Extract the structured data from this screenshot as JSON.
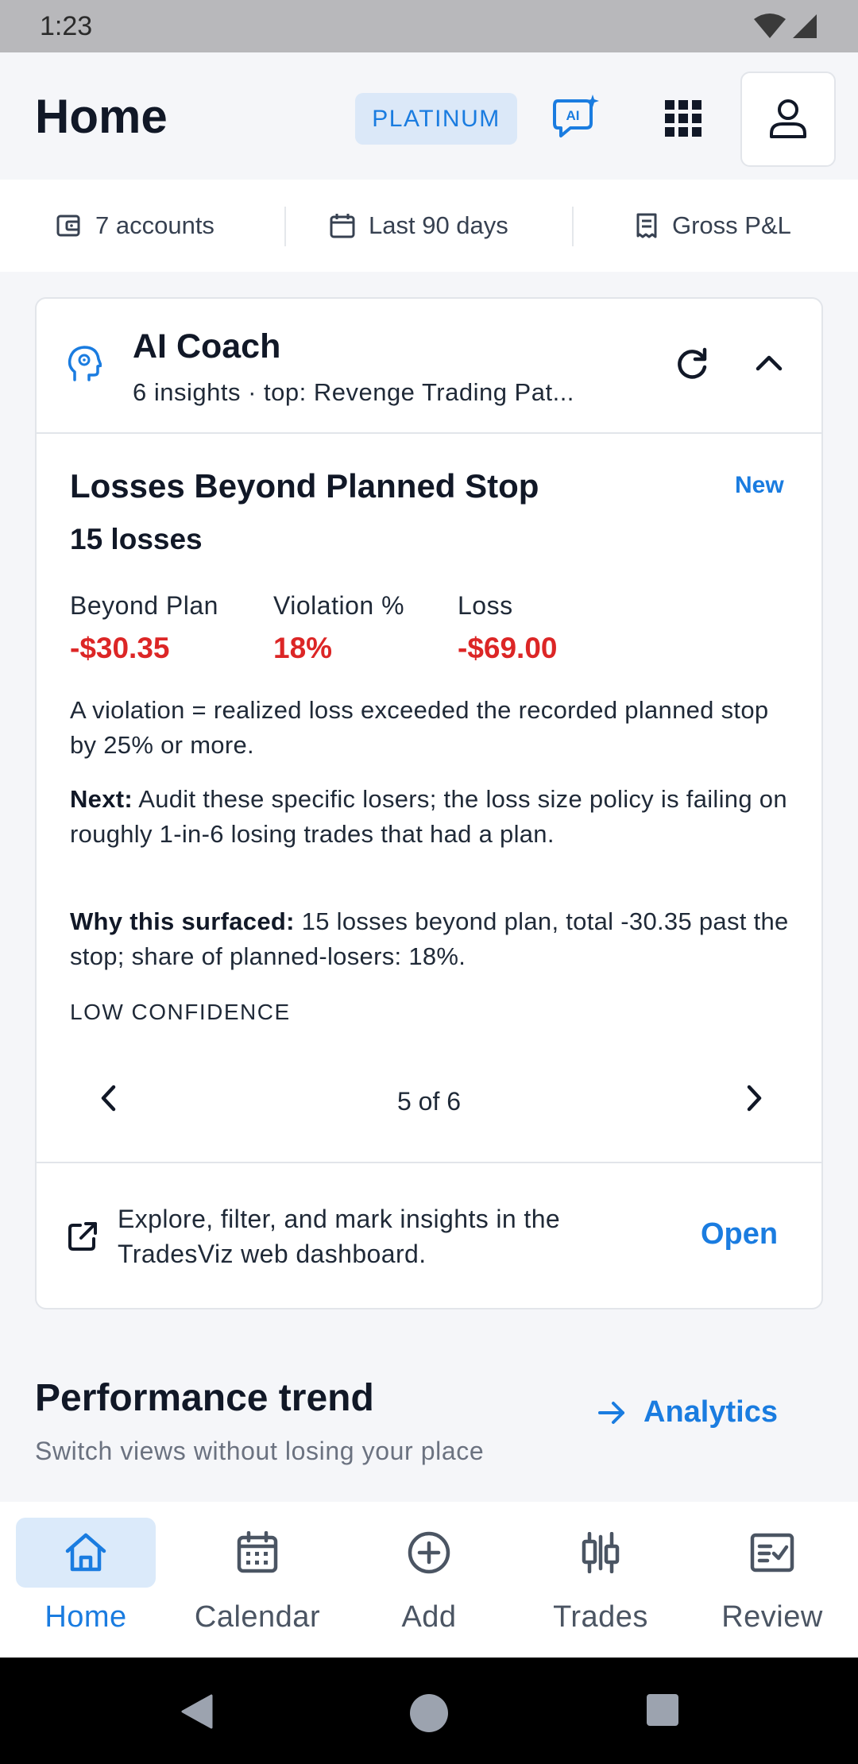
{
  "status_bar": {
    "time": "1:23"
  },
  "header": {
    "title": "Home",
    "plan_badge": "PLATINUM",
    "ai_icon_text": "AI"
  },
  "filters": {
    "accounts": "7 accounts",
    "range": "Last 90 days",
    "metric": "Gross P&L"
  },
  "ai_coach": {
    "title": "AI Coach",
    "subtitle": "6 insights · top: Revenge Trading Pat...",
    "insight": {
      "title": "Losses Beyond Planned Stop",
      "badge": "New",
      "count": "15 losses",
      "metrics": [
        {
          "label": "Beyond Plan",
          "value": "-$30.35"
        },
        {
          "label": "Violation %",
          "value": "18%"
        },
        {
          "label": "Loss",
          "value": "-$69.00"
        }
      ],
      "definition": "A violation = realized loss exceeded the recorded planned stop by 25% or more.",
      "next_label": "Next:",
      "next_text": " Audit these specific losers; the loss size policy is failing on roughly 1-in-6 losing trades that had a plan.",
      "why_label": "Why this surfaced:",
      "why_text": " 15 losses beyond plan, total -30.35 past the stop; share of planned-losers: 18%.",
      "confidence": "LOW CONFIDENCE"
    },
    "pager": "5 of 6",
    "explore_text": "Explore, filter, and mark insights in the TradesViz web dashboard.",
    "explore_link": "Open"
  },
  "performance": {
    "title": "Performance trend",
    "subtitle": "Switch views without losing your place",
    "link": "Analytics"
  },
  "bottom_nav": [
    {
      "label": "Home",
      "icon": "home-icon",
      "active": true
    },
    {
      "label": "Calendar",
      "icon": "calendar-icon",
      "active": false
    },
    {
      "label": "Add",
      "icon": "add-circle-icon",
      "active": false
    },
    {
      "label": "Trades",
      "icon": "candlestick-icon",
      "active": false
    },
    {
      "label": "Review",
      "icon": "review-checklist-icon",
      "active": false
    }
  ],
  "colors": {
    "accent": "#1a7ce0",
    "negative": "#dc2626",
    "badge_bg": "#dbe8f8"
  }
}
